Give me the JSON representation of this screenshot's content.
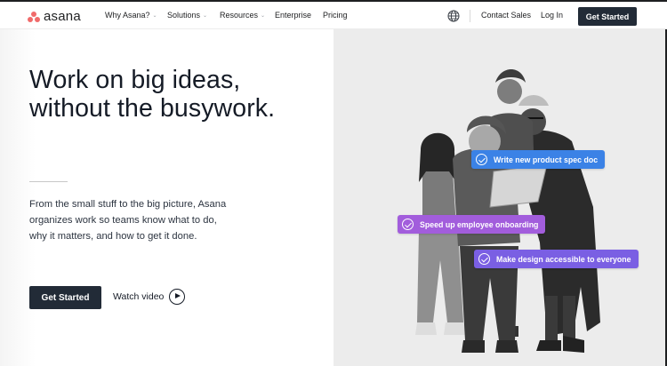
{
  "brand": {
    "name": "asana",
    "logo_color": "#f06a6a"
  },
  "nav": {
    "items": [
      {
        "label": "Why Asana?",
        "has_dropdown": true
      },
      {
        "label": "Solutions",
        "has_dropdown": true
      },
      {
        "label": "Resources",
        "has_dropdown": true
      },
      {
        "label": "Enterprise",
        "has_dropdown": false
      },
      {
        "label": "Pricing",
        "has_dropdown": false
      }
    ],
    "chevron_glyph": "⌄",
    "language_icon": "globe-icon",
    "contact_label": "Contact Sales",
    "login_label": "Log In",
    "cta_label": "Get Started"
  },
  "hero": {
    "headline_line1": "Work on big ideas,",
    "headline_line2": "without the busywork.",
    "description": "From the small stuff to the big picture, Asana organizes work so teams know what to do, why it matters, and how to get it done.",
    "cta_label": "Get Started",
    "watch_label": "Watch video",
    "watch_icon": "play-icon"
  },
  "tasks": [
    {
      "label": "Write new product spec doc",
      "color": "#3b82e6"
    },
    {
      "label": "Speed up employee onboarding",
      "color": "#a25ddc"
    },
    {
      "label": "Make design accessible to everyone",
      "color": "#7a5fe3"
    }
  ],
  "colors": {
    "primary_dark": "#222b37",
    "text": "#151b26",
    "hero_bg": "#ececec"
  }
}
